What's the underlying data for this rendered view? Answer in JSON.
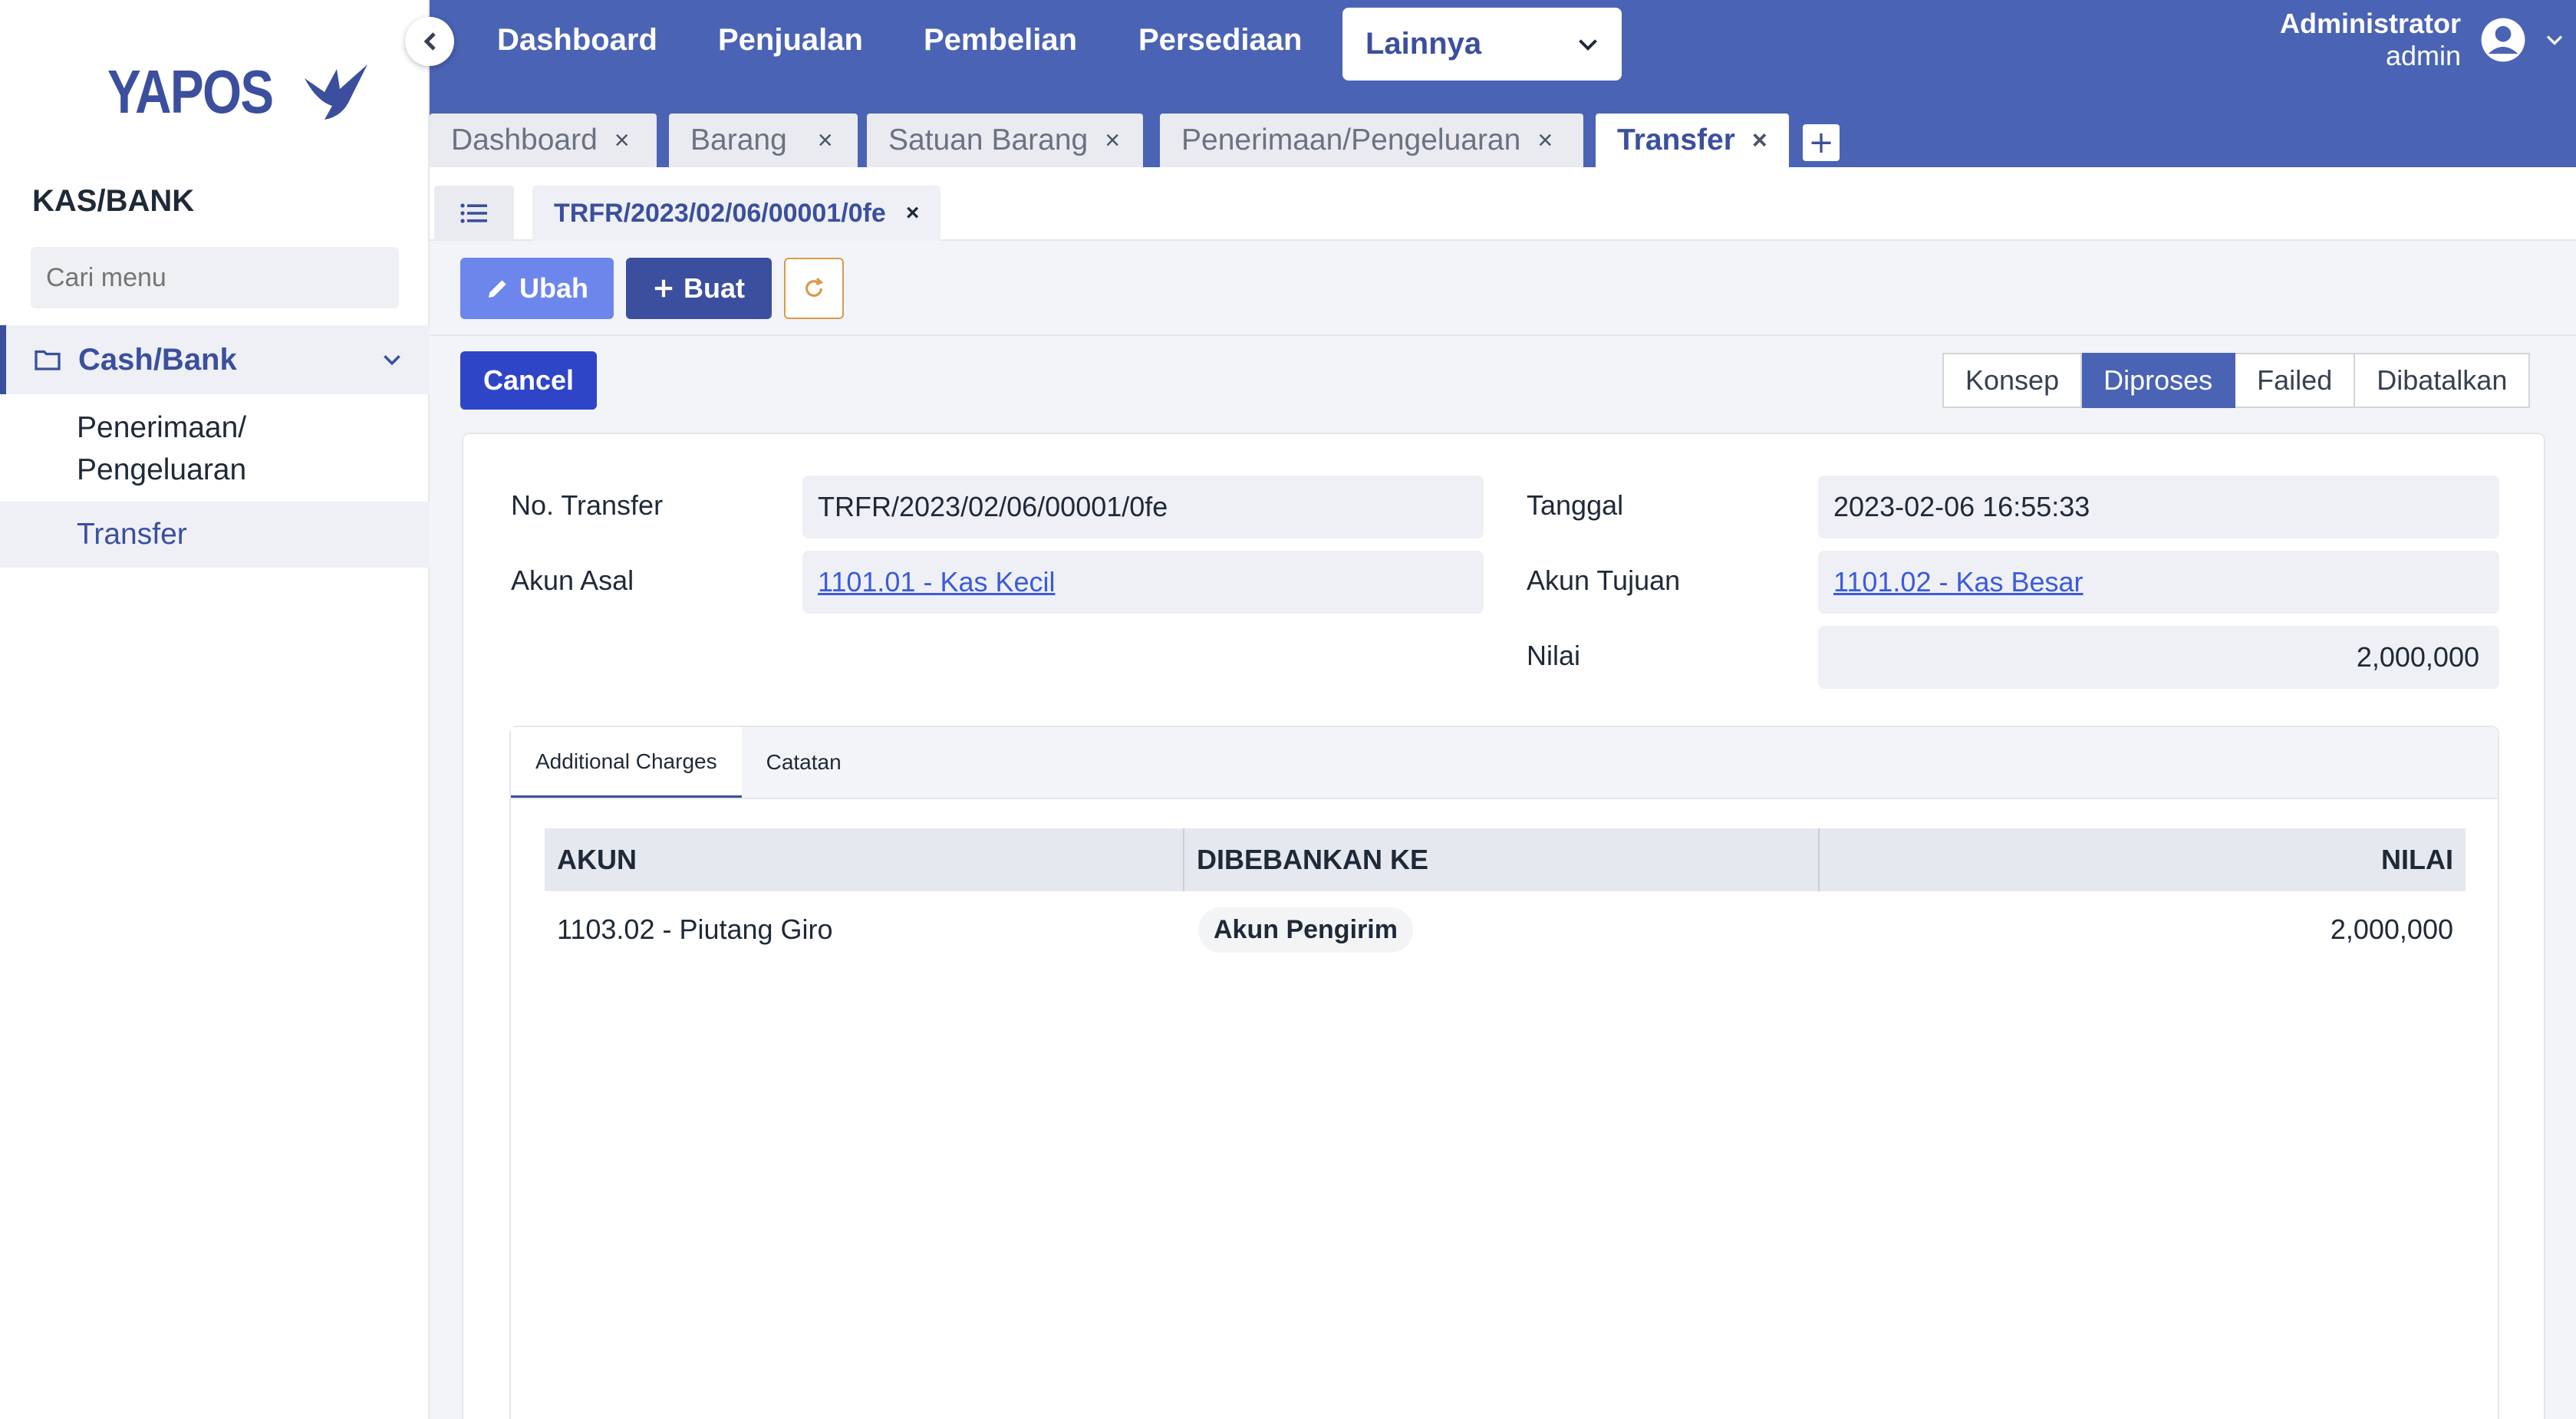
{
  "app": {
    "logo_text": "YAPOS"
  },
  "sidebar": {
    "section_title": "KAS/BANK",
    "search_placeholder": "Cari menu",
    "group_label": "Cash/Bank",
    "items": [
      {
        "label_line1": "Penerimaan/",
        "label_line2": "Pengeluaran"
      },
      {
        "label": "Transfer"
      }
    ]
  },
  "topnav": {
    "items": [
      "Dashboard",
      "Penjualan",
      "Pembelian",
      "Persediaan"
    ],
    "dropdown_label": "Lainnya",
    "user_name": "Administrator",
    "user_role": "admin"
  },
  "tabs": [
    "Dashboard",
    "Barang",
    "Satuan Barang",
    "Penerimaan/Pengeluaran",
    "Transfer"
  ],
  "record_tab": "TRFR/2023/02/06/00001/0fe",
  "toolbar": {
    "edit_label": "Ubah",
    "create_label": "Buat"
  },
  "cancel_label": "Cancel",
  "statuses": [
    "Konsep",
    "Diproses",
    "Failed",
    "Dibatalkan"
  ],
  "form": {
    "no_transfer_label": "No. Transfer",
    "no_transfer_value": "TRFR/2023/02/06/00001/0fe",
    "tanggal_label": "Tanggal",
    "tanggal_value": "2023-02-06  16:55:33",
    "akun_asal_label": "Akun Asal",
    "akun_asal_value": "1101.01 - Kas Kecil",
    "akun_tujuan_label": "Akun Tujuan",
    "akun_tujuan_value": "1101.02 - Kas Besar",
    "nilai_label": "Nilai",
    "nilai_value": "2,000,000"
  },
  "inner_tabs": [
    "Additional Charges",
    "Catatan"
  ],
  "table": {
    "headers": [
      "AKUN",
      "DIBEBANKAN KE",
      "NILAI"
    ],
    "rows": [
      {
        "akun": "1103.02 - Piutang Giro",
        "dibebankan": "Akun Pengirim",
        "nilai": "2,000,000"
      }
    ]
  },
  "colors": {
    "primary": "#4a63b5",
    "accent": "#3b4f9e",
    "cancel": "#2f45c8",
    "edit": "#6d86ec"
  }
}
